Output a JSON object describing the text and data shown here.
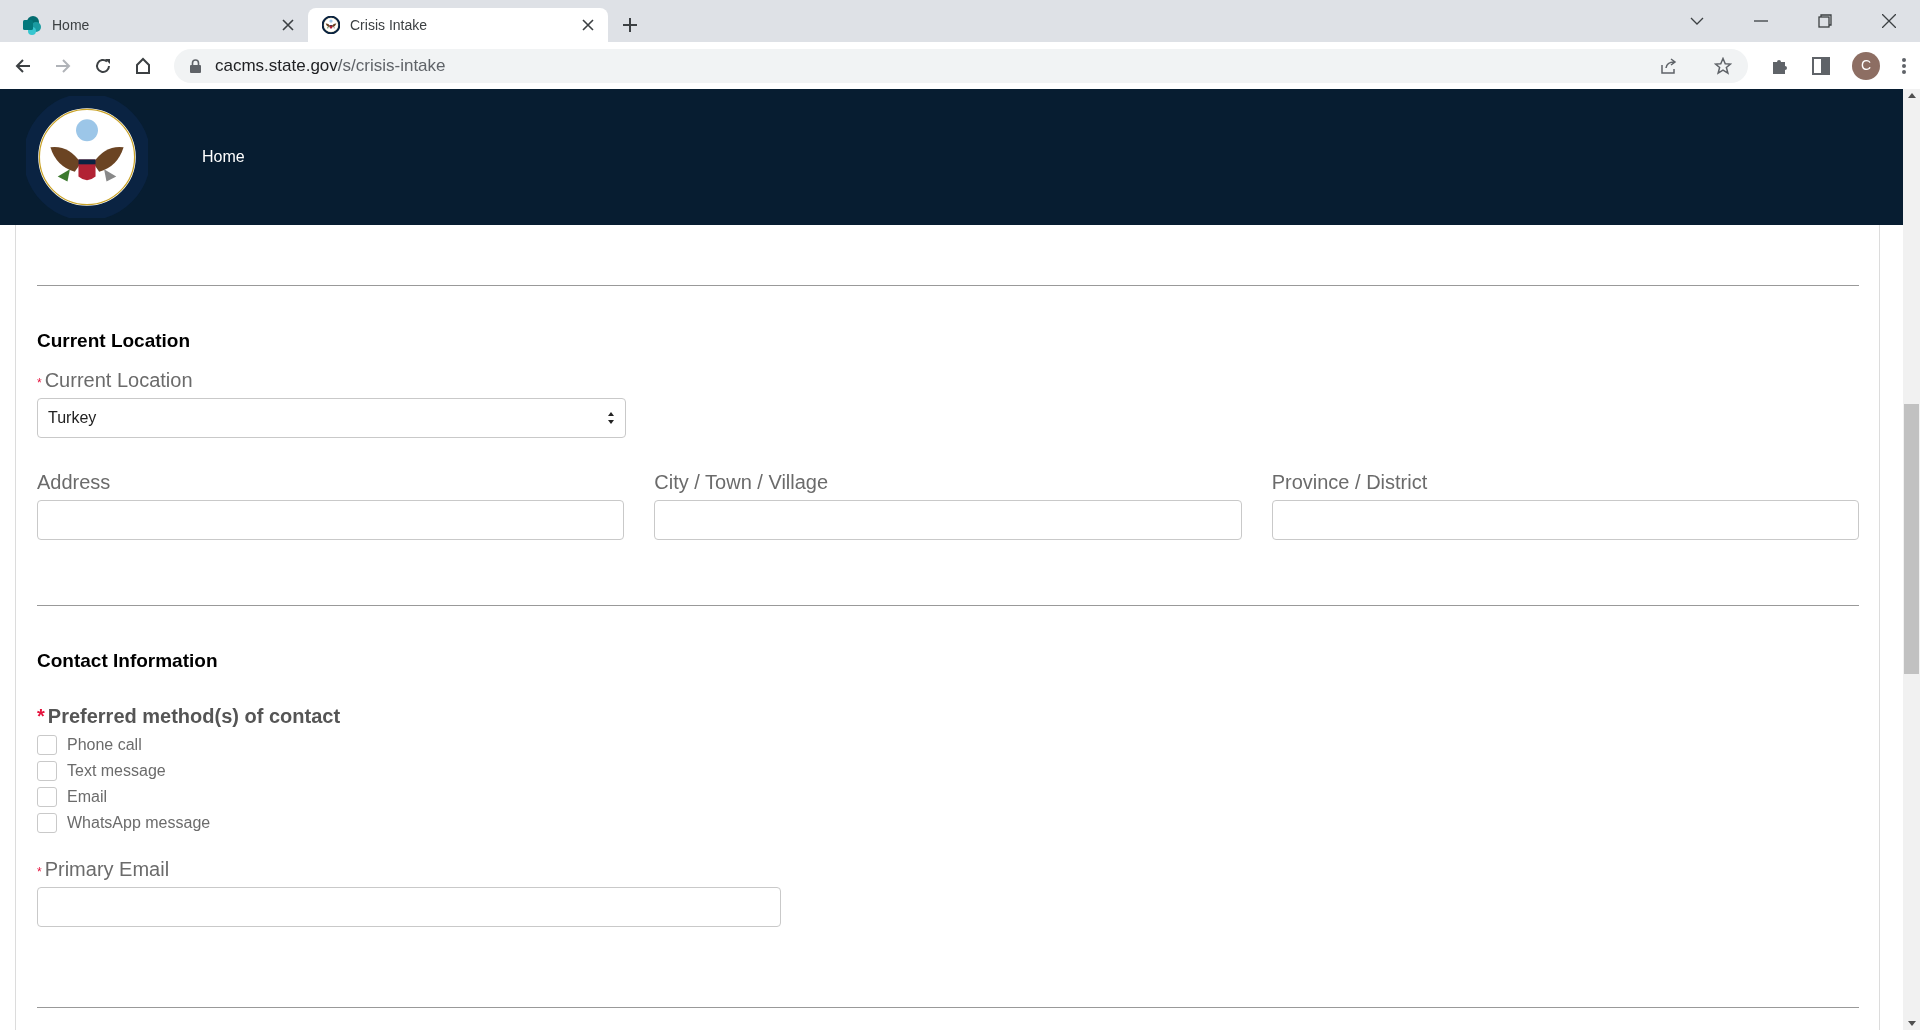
{
  "browser": {
    "tabs": [
      {
        "title": "Home",
        "selected": false,
        "kind": "sharepoint"
      },
      {
        "title": "Crisis Intake",
        "selected": true,
        "kind": "seal"
      }
    ],
    "url_host": "cacms.state.gov",
    "url_path": "/s/crisis-intake",
    "profile_initial": "C"
  },
  "header": {
    "nav": [
      "Home"
    ]
  },
  "sections": [
    {
      "title": "Current Location",
      "fields": [
        {
          "kind": "select",
          "marker": "*",
          "label": "Current Location",
          "value": "Turkey"
        }
      ]
    },
    {
      "fields": [
        {
          "kind": "text",
          "label": "Address"
        },
        {
          "kind": "text",
          "label": "City / Town / Village"
        },
        {
          "kind": "text",
          "label": "Province / District"
        }
      ]
    },
    {
      "title": "Contact Information",
      "fields": [
        {
          "kind": "checkboxes",
          "marker": "*",
          "label": "Preferred method(s) of contact",
          "options": [
            {
              "label": "Phone call",
              "checked": false
            },
            {
              "label": "Text message",
              "checked": false
            },
            {
              "label": "Email",
              "checked": false
            },
            {
              "label": "WhatsApp message",
              "checked": false
            }
          ]
        },
        {
          "kind": "email",
          "marker": "*",
          "label": "Primary Email"
        }
      ]
    }
  ]
}
